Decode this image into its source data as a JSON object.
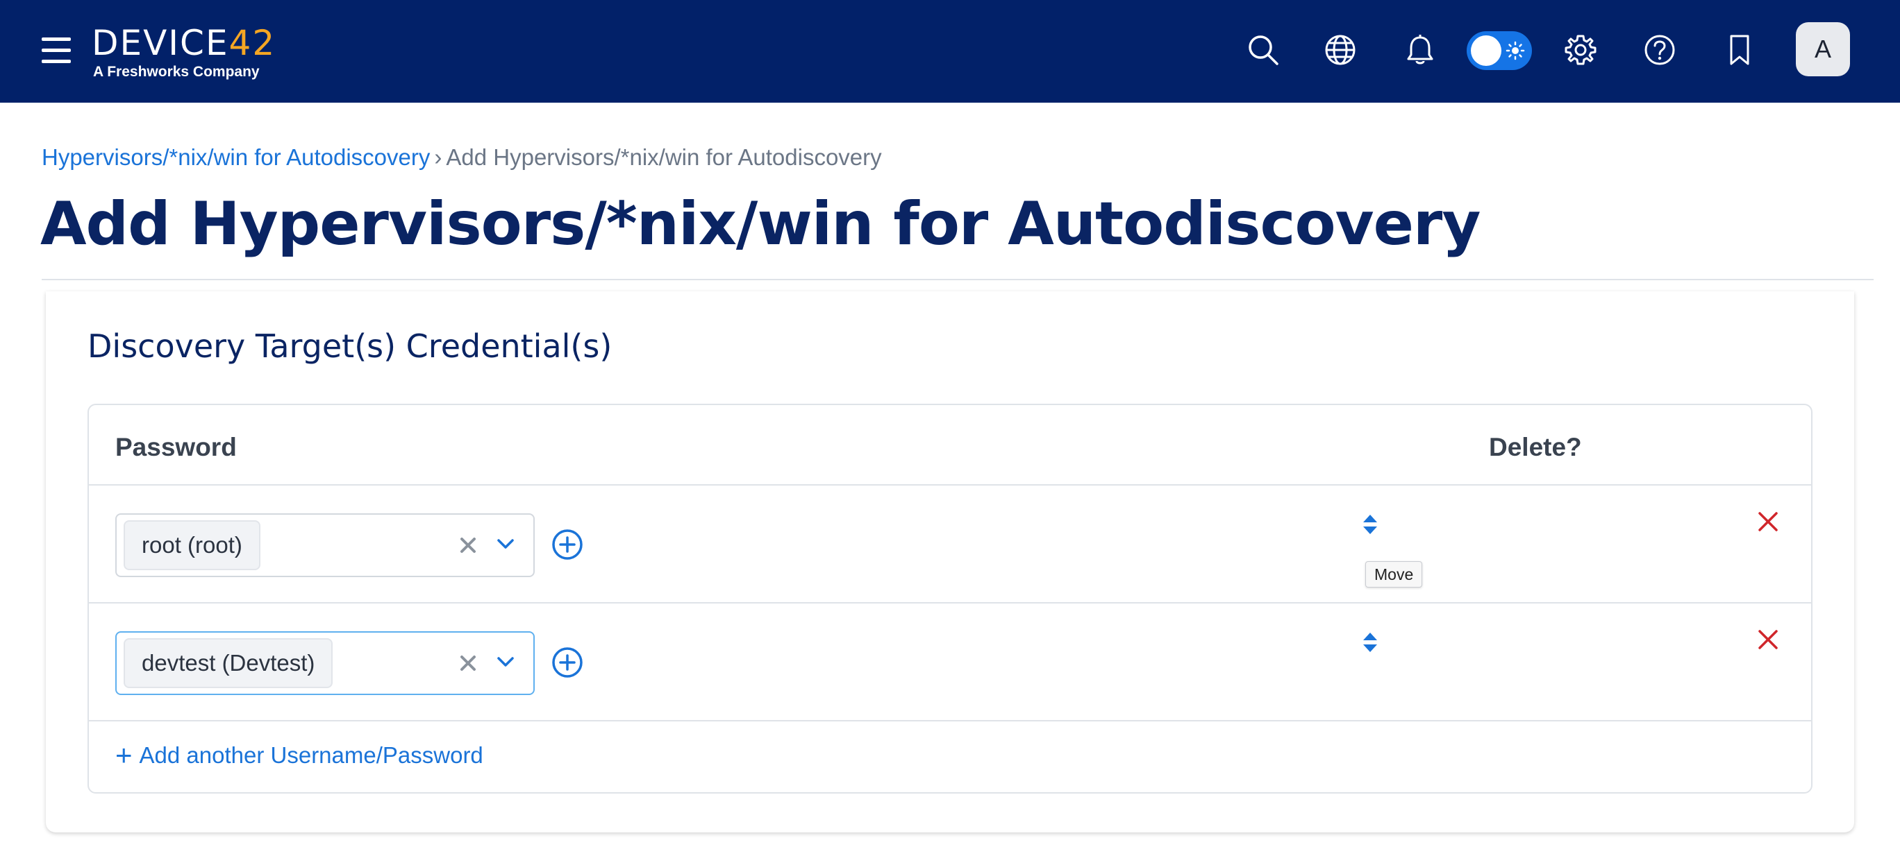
{
  "header": {
    "logo_text_main": "DEVICE",
    "logo_text_accent": "42",
    "logo_subtitle": "A Freshworks Company",
    "icons": [
      "menu-icon",
      "search-icon",
      "globe-icon",
      "bell-icon",
      "theme-toggle",
      "gear-icon",
      "help-icon",
      "bookmark-icon"
    ],
    "avatar_initial": "A",
    "theme_toggle_on": true
  },
  "breadcrumb": {
    "parent": "Hypervisors/*nix/win for Autodiscovery",
    "separator": "›",
    "current": "Add Hypervisors/*nix/win for Autodiscovery"
  },
  "page": {
    "title": "Add Hypervisors/*nix/win for Autodiscovery"
  },
  "credentials": {
    "section_title": "Discovery Target(s) Credential(s)",
    "columns": {
      "password": "Password",
      "delete": "Delete?"
    },
    "rows": [
      {
        "value": "root (root)",
        "focused": false
      },
      {
        "value": "devtest (Devtest)",
        "focused": true
      }
    ],
    "tooltip": "Move",
    "add_link": "Add another Username/Password",
    "add_link_prefix": "+"
  },
  "colors": {
    "header_bg": "#022169",
    "title": "#0a2463",
    "link": "#1a73d8",
    "delete": "#d0262b",
    "logo_accent": "#f5a623"
  }
}
